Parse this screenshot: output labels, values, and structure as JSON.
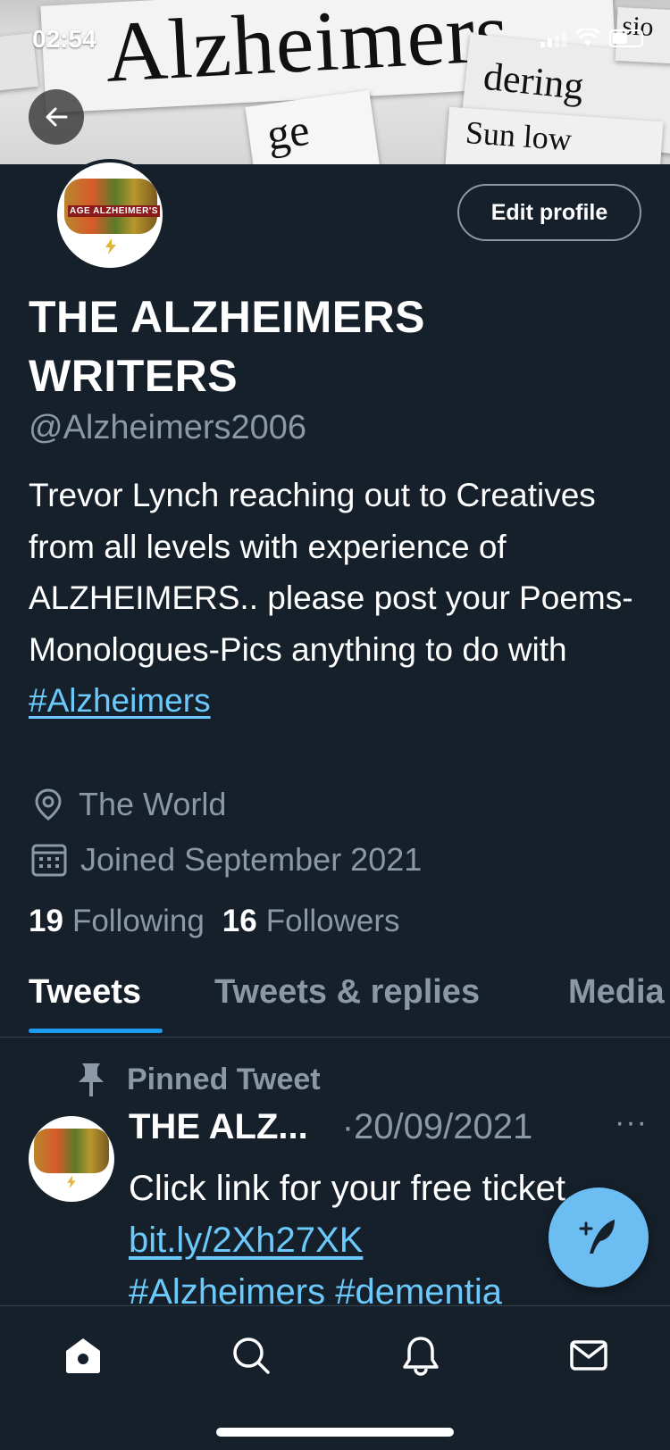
{
  "status_bar": {
    "time": "02:54"
  },
  "banner": {
    "headline_word": "Alzheimers",
    "scrap_words": [
      "dering",
      "ge",
      "Sun low",
      "sio"
    ]
  },
  "profile": {
    "edit_label": "Edit profile",
    "display_name": "THE ALZHEIMERS WRITERS",
    "handle": "@Alzheimers2006",
    "bio_text": "Trevor Lynch reaching out to Creatives from all levels with experience of ALZHEIMERS.. please post your Poems-Monologues-Pics anything to do with ",
    "bio_hashtag": "#Alzheimers",
    "location": "The World",
    "joined": "Joined September 2021",
    "following_count": "19",
    "following_label": "Following",
    "followers_count": "16",
    "followers_label": "Followers",
    "avatar_text": "AGE ALZHEIMER'S"
  },
  "tabs": [
    {
      "label": "Tweets",
      "active": true
    },
    {
      "label": "Tweets & replies",
      "active": false
    },
    {
      "label": "Media",
      "active": false
    }
  ],
  "pinned_tweet": {
    "pinned_label": "Pinned Tweet",
    "author": "THE ALZ...",
    "date": "·20/09/2021",
    "more": "···",
    "line1": "Click link for your free ticket",
    "link": "bit.ly/2Xh27XK",
    "hashtag1": "#Alzheimers",
    "hashtag2": "#dementia"
  },
  "colors": {
    "background": "#15202b",
    "accent": "#1d9bf0",
    "link": "#6bc9fb",
    "muted": "#8b98a5",
    "fab": "#6bbdf2"
  },
  "icons": [
    "back-arrow-icon",
    "location-pin-icon",
    "calendar-icon",
    "pin-icon",
    "compose-icon",
    "home-icon",
    "search-icon",
    "bell-icon",
    "mail-icon"
  ]
}
